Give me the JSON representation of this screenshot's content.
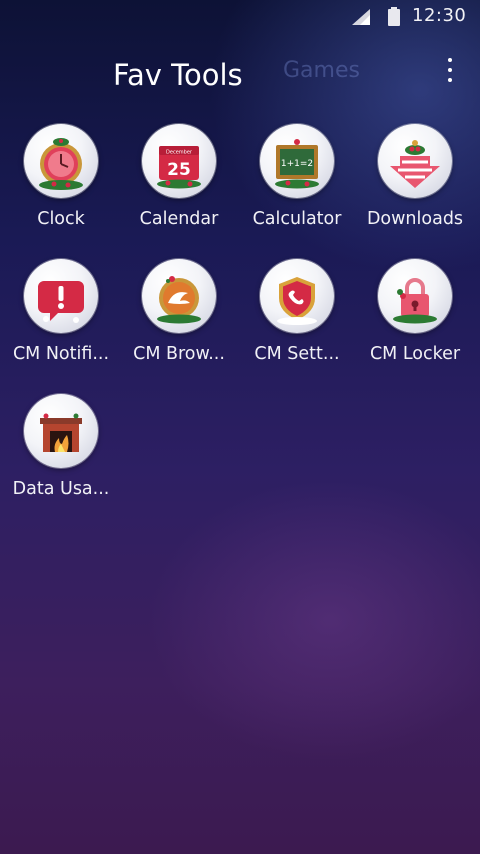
{
  "status_bar": {
    "time": "12:30",
    "signal_icon": "signal-icon",
    "battery_icon": "battery-icon"
  },
  "header": {
    "active_tab": "Fav Tools",
    "inactive_tab": "Games",
    "menu_icon": "overflow-menu-icon"
  },
  "apps": [
    {
      "label": "Clock",
      "icon": "clock-icon"
    },
    {
      "label": "Calendar",
      "icon": "calendar-icon",
      "icon_text": "25",
      "icon_month": "December"
    },
    {
      "label": "Calculator",
      "icon": "calculator-icon",
      "icon_text": "1+1=2"
    },
    {
      "label": "Downloads",
      "icon": "downloads-icon"
    },
    {
      "label": "CM Notifi...",
      "icon": "notification-icon"
    },
    {
      "label": "CM Brow...",
      "icon": "browser-icon"
    },
    {
      "label": "CM Sett...",
      "icon": "settings-icon"
    },
    {
      "label": "CM Locker",
      "icon": "locker-icon"
    },
    {
      "label": "Data Usa...",
      "icon": "fireplace-icon"
    }
  ],
  "colors": {
    "accent_red": "#d42a45",
    "accent_green": "#2c7a33",
    "accent_gold": "#d9a23a"
  }
}
